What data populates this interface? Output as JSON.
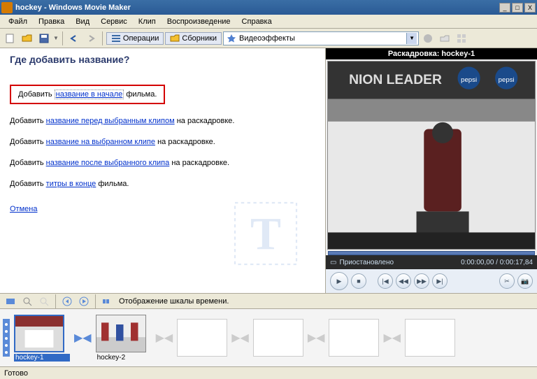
{
  "title": "hockey - Windows Movie Maker",
  "menu": [
    "Файл",
    "Правка",
    "Вид",
    "Сервис",
    "Клип",
    "Воспроизведение",
    "Справка"
  ],
  "toolbar": {
    "ops": "Операции",
    "coll": "Сборники",
    "ddl": "Видеоэффекты"
  },
  "task": {
    "heading": "Где добавить название?",
    "o1p": "Добавить ",
    "o1a": "название в начале",
    "o1s": " фильма.",
    "o2p": "Добавить ",
    "o2a": "название перед выбранным клипом",
    "o2s": " на раскадровке.",
    "o3p": "Добавить ",
    "o3a": "название на выбранном клипе",
    "o3s": " на раскадровке.",
    "o4p": "Добавить ",
    "o4a": "название после выбранного клипа",
    "o4s": " на раскадровке.",
    "o5p": "Добавить ",
    "o5a": "титры в конце",
    "o5s": " фильма.",
    "cancel": "Отмена"
  },
  "preview": {
    "title": "Раскадровка: hockey-1",
    "status": "Приостановлено",
    "time": "0:00:00,00 / 0:00:17,84"
  },
  "timeline": {
    "label": "Отображение шкалы времени.",
    "clip1": "hockey-1",
    "clip2": "hockey-2"
  },
  "status": "Готово"
}
